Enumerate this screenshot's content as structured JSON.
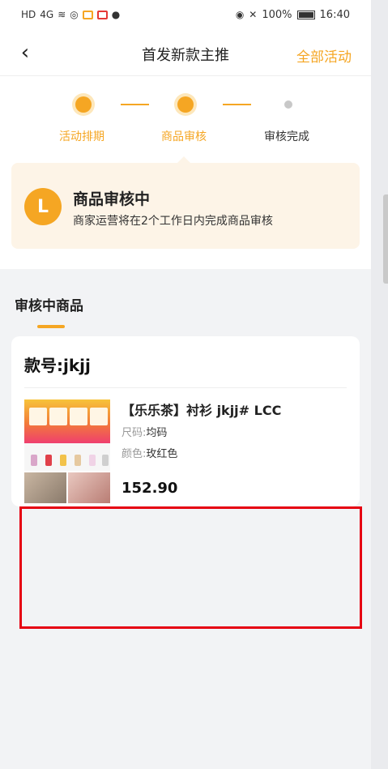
{
  "status_bar": {
    "network": "4G",
    "battery": "100%",
    "time": "16:40"
  },
  "header": {
    "title": "首发新款主推",
    "right_link": "全部活动"
  },
  "steps": [
    {
      "label": "活动排期",
      "state": "done"
    },
    {
      "label": "商品审核",
      "state": "current"
    },
    {
      "label": "审核完成",
      "state": "todo"
    }
  ],
  "status_card": {
    "icon_letter": "L",
    "title": "商品审核中",
    "description": "商家运营将在2个工作日内完成商品审核"
  },
  "section": {
    "title": "审核中商品"
  },
  "product": {
    "style_no": "款号:jkjj",
    "name": "【乐乐茶】衬衫 jkjj# LCC",
    "size_label": "尺码:",
    "size_value": "均码",
    "color_label": "颜色:",
    "color_value": "玫红色",
    "price": "152.90"
  },
  "colors": {
    "accent": "#f5a623",
    "highlight_border": "#e60012"
  }
}
